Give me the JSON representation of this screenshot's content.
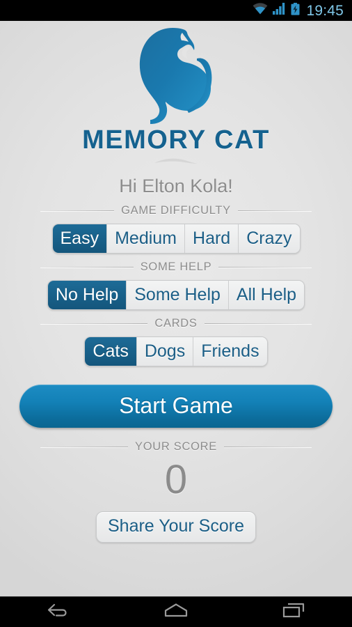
{
  "status_bar": {
    "wifi_icon": "wifi-icon",
    "signal_icon": "cellular-signal-icon",
    "battery_icon": "battery-charging-icon",
    "clock": "19:45",
    "clock_color": "#7fc7e8"
  },
  "logo": {
    "icon_name": "cat-silhouette-logo",
    "brand_title": "MEMORY CAT",
    "brand_color": "#15628f",
    "flourish_name": "cat-flourish-ornament"
  },
  "greeting": "Hi Elton Kola!",
  "sections": {
    "difficulty": {
      "label": "GAME DIFFICULTY",
      "options": [
        "Easy",
        "Medium",
        "Hard",
        "Crazy"
      ],
      "selected": "Easy"
    },
    "help": {
      "label": "SOME HELP",
      "options": [
        "No Help",
        "Some Help",
        "All Help"
      ],
      "selected": "No Help"
    },
    "cards": {
      "label": "CARDS",
      "options": [
        "Cats",
        "Dogs",
        "Friends"
      ],
      "selected": "Cats"
    },
    "score": {
      "label": "YOUR SCORE",
      "value": "0"
    }
  },
  "buttons": {
    "start_game": "Start Game",
    "share_score": "Share Your Score"
  },
  "nav_bar": {
    "back_icon": "back-arrow-icon",
    "home_icon": "home-icon",
    "recents_icon": "recent-apps-icon"
  },
  "colors": {
    "accent_blue": "#15628f",
    "selected_segment": "#16597f",
    "start_button_blue": "#1280b6",
    "background_grey": "#e3e3e3",
    "muted_text": "#8c8c8c"
  }
}
